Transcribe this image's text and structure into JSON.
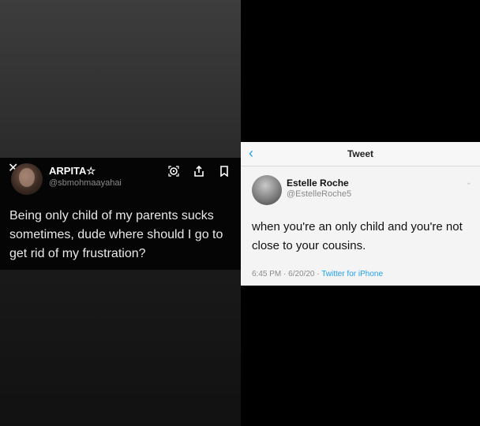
{
  "left_tweet": {
    "name": "ARPITA☆",
    "handle": "@sbmohmaayahai",
    "text": "Being only child of my parents sucks sometimes, dude where should I go to get rid of my frustration?"
  },
  "right_tweet": {
    "nav_title": "Tweet",
    "name": "Estelle Roche",
    "handle": "@EstelleRoche5",
    "text": "when you're an only child and you're not close to your cousins.",
    "time": "6:45 PM · 6/20/20 · ",
    "source": "Twitter for iPhone"
  },
  "colors": {
    "accent": "#1da1f2"
  }
}
